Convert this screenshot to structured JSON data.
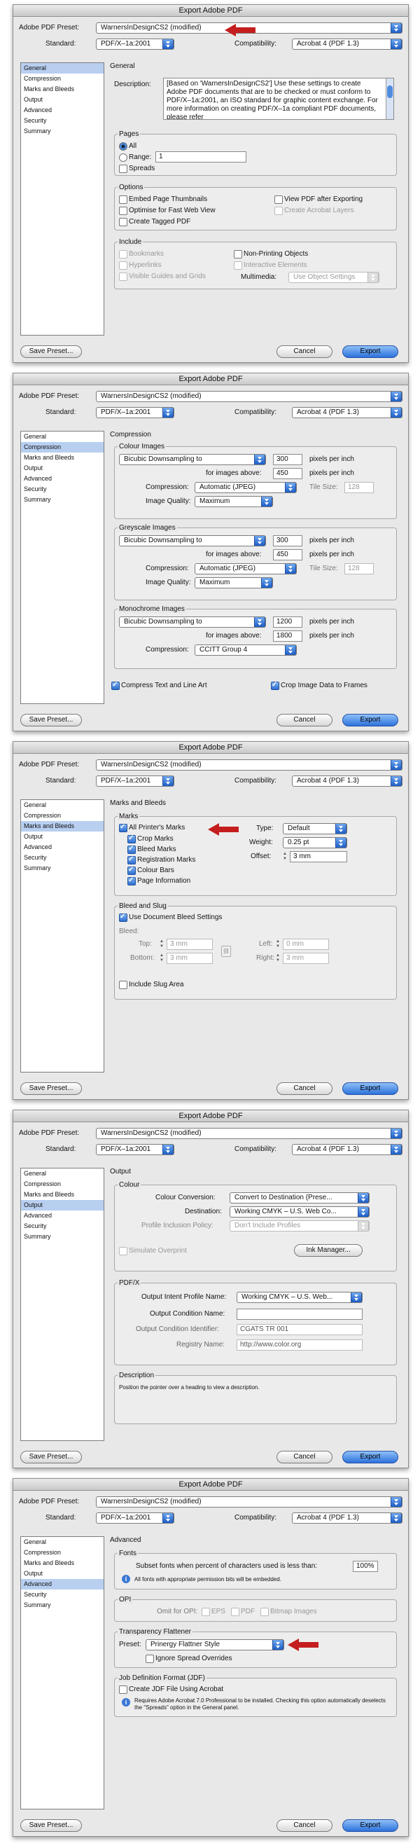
{
  "dialog_title": "Export Adobe PDF",
  "preset_label": "Adobe PDF Preset:",
  "standard_label": "Standard:",
  "compat_label": "Compatibility:",
  "preset_modified": "WarnersInDesignCS2 (modified)",
  "standard": "PDF/X–1a:2001",
  "compat": "Acrobat 4 (PDF 1.3)",
  "sidebar": [
    "General",
    "Compression",
    "Marks and Bleeds",
    "Output",
    "Advanced",
    "Security",
    "Summary"
  ],
  "buttons": {
    "save": "Save Preset...",
    "cancel": "Cancel",
    "export": "Export"
  },
  "general": {
    "heading": "General",
    "desc_label": "Description:",
    "description": "[Based on 'WarnersInDesignCS2'] Use these settings to create Adobe PDF documents that are to be checked or must conform to PDF/X–1a:2001, an ISO standard for graphic content exchange.  For more information on creating PDF/X–1a compliant PDF documents, please refer",
    "pages": "Pages",
    "all": "All",
    "range": "Range:",
    "range_value": "1",
    "spreads": "Spreads",
    "options": "Options",
    "thumbs": "Embed Page Thumbnails",
    "fastweb": "Optimise for Fast Web View",
    "tagged": "Create Tagged PDF",
    "viewpdf": "View PDF after Exporting",
    "layers": "Create Acrobat Layers",
    "include": "Include",
    "bookmarks": "Bookmarks",
    "hyperlinks": "Hyperlinks",
    "guides": "Visible Guides and Grids",
    "nonprint": "Non-Printing Objects",
    "interactive": "Interactive Elements",
    "multimedia": "Multimedia:",
    "multimedia_value": "Use Object Settings"
  },
  "compression": {
    "heading": "Compression",
    "groups": [
      {
        "title": "Colour Images",
        "method": "Bicubic Downsampling to",
        "ppi": "300",
        "above": "450",
        "comp": "Automatic (JPEG)",
        "quality": "Maximum",
        "tile": "128"
      },
      {
        "title": "Greyscale Images",
        "method": "Bicubic Downsampling to",
        "ppi": "300",
        "above": "450",
        "comp": "Automatic (JPEG)",
        "quality": "Maximum",
        "tile": "128"
      },
      {
        "title": "Monochrome Images",
        "method": "Bicubic Downsampling to",
        "ppi": "1200",
        "above": "1800",
        "comp": "CCITT Group 4"
      }
    ],
    "ppi_label": "pixels per inch",
    "above_label": "for images above:",
    "comp_label": "Compression:",
    "quality_label": "Image Quality:",
    "tile_label": "Tile Size:",
    "compress_text": "Compress Text and Line Art",
    "crop": "Crop Image Data to Frames"
  },
  "marks": {
    "heading": "Marks and Bleeds",
    "marks": "Marks",
    "all": "All Printer's Marks",
    "crop": "Crop Marks",
    "bleed": "Bleed Marks",
    "reg": "Registration Marks",
    "colour": "Colour Bars",
    "info": "Page Information",
    "type_label": "Type:",
    "type": "Default",
    "weight_label": "Weight:",
    "weight": "0.25 pt",
    "offset_label": "Offset:",
    "offset": "3 mm",
    "bs": "Bleed and Slug",
    "use_doc": "Use Document Bleed Settings",
    "bleed_label": "Bleed:",
    "top": "Top:",
    "bottom": "Bottom:",
    "left": "Left:",
    "right": "Right:",
    "top_v": "3 mm",
    "bottom_v": "3 mm",
    "left_v": "0 mm",
    "right_v": "3 mm",
    "slug": "Include Slug Area"
  },
  "output": {
    "heading": "Output",
    "colour": "Colour",
    "conv_label": "Colour Conversion:",
    "conv": "Convert to Destination (Prese...",
    "dest_label": "Destination:",
    "dest": "Working CMYK – U.S. Web Co...",
    "pip_label": "Profile Inclusion Policy:",
    "pip": "Don't Include Profiles",
    "sim": "Simulate Overprint",
    "ink": "Ink Manager...",
    "pdfx": "PDF/X",
    "oip_label": "Output Intent Profile Name:",
    "oip": "Working CMYK – U.S. Web...",
    "ocn_label": "Output Condition Name:",
    "oci_label": "Output Condition Identifier:",
    "oci": "CGATS TR 001",
    "reg_label": "Registry Name:",
    "reg": "http://www.color.org",
    "desc": "Description",
    "desc_text": "Position the pointer over a heading to view a description."
  },
  "advanced": {
    "heading": "Advanced",
    "fonts": "Fonts",
    "subset": "Subset fonts when percent of characters used is less than:",
    "subset_v": "100%",
    "fonts_note": "All fonts with appropriate permission bits will be embedded.",
    "opi": "OPI",
    "omit": "Omit for OPI:",
    "eps": "EPS",
    "pdf": "PDF",
    "bitmap": "Bitmap Images",
    "tf": "Transparency Flattener",
    "preset_label": "Preset:",
    "preset": "Prinergy Flattner Style",
    "ignore": "Ignore Spread Overrides",
    "jdf": "Job Definition Format (JDF)",
    "create_jdf": "Create JDF File Using Acrobat",
    "jdf_note": "Requires Adobe Acrobat 7.0 Professional to be installed. Checking this option automatically deselects the \"Spreads\" option in the General panel."
  }
}
